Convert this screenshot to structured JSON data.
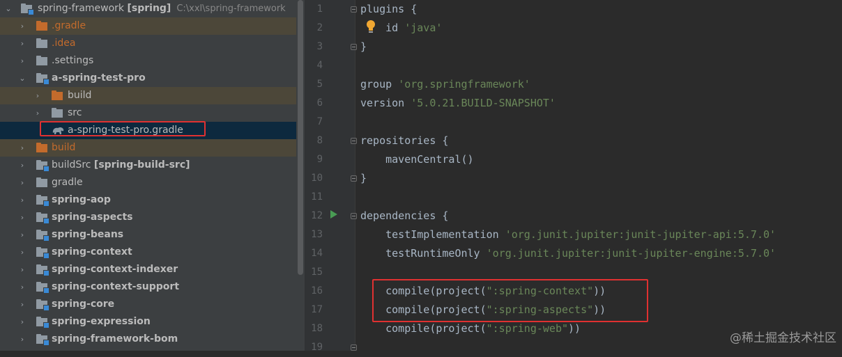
{
  "project_tree": {
    "root": {
      "name": "spring-framework",
      "module": "[spring]",
      "path": "C:\\xxl\\spring-framework"
    },
    "items": [
      {
        "label": ".gradle"
      },
      {
        "label": ".idea"
      },
      {
        "label": ".settings"
      },
      {
        "label": "a-spring-test-pro"
      },
      {
        "label": "build"
      },
      {
        "label": "src"
      },
      {
        "label": "a-spring-test-pro.gradle"
      },
      {
        "label": "build"
      },
      {
        "label": "buildSrc",
        "module": "[spring-build-src]"
      },
      {
        "label": "gradle"
      },
      {
        "label": "spring-aop"
      },
      {
        "label": "spring-aspects"
      },
      {
        "label": "spring-beans"
      },
      {
        "label": "spring-context"
      },
      {
        "label": "spring-context-indexer"
      },
      {
        "label": "spring-context-support"
      },
      {
        "label": "spring-core"
      },
      {
        "label": "spring-expression"
      },
      {
        "label": "spring-framework-bom"
      }
    ]
  },
  "editor": {
    "line_numbers": [
      "1",
      "2",
      "3",
      "4",
      "5",
      "6",
      "7",
      "8",
      "9",
      "10",
      "11",
      "12",
      "13",
      "14",
      "15",
      "16",
      "17",
      "18",
      "19"
    ],
    "lines": [
      {
        "code": "plugins {"
      },
      {
        "code": "    id ",
        "str": "'java'"
      },
      {
        "code": "}"
      },
      {
        "code": ""
      },
      {
        "code": "group ",
        "str": "'org.springframework'"
      },
      {
        "code": "version ",
        "str": "'5.0.21.BUILD-SNAPSHOT'"
      },
      {
        "code": ""
      },
      {
        "code": "repositories {"
      },
      {
        "code": "    mavenCentral()"
      },
      {
        "code": "}"
      },
      {
        "code": ""
      },
      {
        "code": "dependencies {"
      },
      {
        "code": "    testImplementation ",
        "str": "'org.junit.jupiter:junit-jupiter-api:5.7.0'"
      },
      {
        "code": "    testRuntimeOnly ",
        "str": "'org.junit.jupiter:junit-jupiter-engine:5.7.0'"
      },
      {
        "code": ""
      },
      {
        "code": "    compile(project(",
        "str": "\":spring-context\"",
        "tail": "))"
      },
      {
        "code": "    compile(project(",
        "str": "\":spring-aspects\"",
        "tail": "))"
      },
      {
        "code": "    compile(project(",
        "str": "\":spring-web\"",
        "tail": "))"
      },
      {
        "code": ""
      }
    ]
  },
  "watermark": "@稀土掘金技术社区",
  "icons": {
    "folder": "folder-icon",
    "module": "module-folder-icon",
    "gradle": "gradle-elephant-icon",
    "bulb": "lightbulb-icon",
    "run": "run-gutter-icon"
  },
  "colors": {
    "tree_bg": "#3c3f41",
    "editor_bg": "#2b2b2b",
    "string": "#6a8759",
    "highlight_box": "#e03131",
    "excluded_folder": "#c36b2c"
  }
}
